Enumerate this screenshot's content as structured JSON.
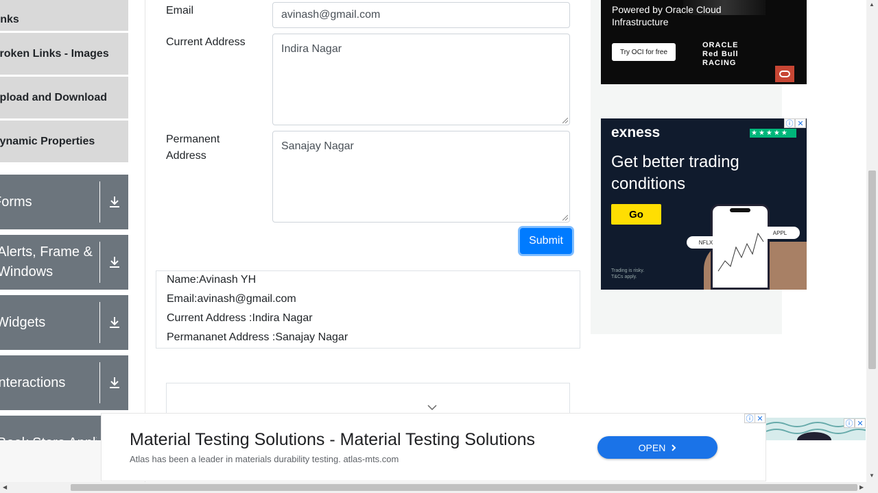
{
  "sidebar": {
    "sub_items": [
      {
        "label": "Links"
      },
      {
        "label": "Broken Links - Images"
      },
      {
        "label": "Upload and Download"
      },
      {
        "label": "Dynamic Properties"
      }
    ],
    "groups": [
      {
        "label": "Forms"
      },
      {
        "label": "Alerts, Frame & Windows"
      },
      {
        "label": "Widgets"
      },
      {
        "label": "Interactions"
      },
      {
        "label": "Book Store Application"
      }
    ]
  },
  "form": {
    "email_label": "Email",
    "email_value": "avinash@gmail.com",
    "current_address_label": "Current Address",
    "current_address_value": "Indira Nagar",
    "permanent_address_label": "Permanent Address",
    "permanent_address_value": "Sanajay Nagar",
    "submit_label": "Submit"
  },
  "output": {
    "name": "Name:Avinash YH",
    "email": "Email:avinash@gmail.com",
    "current_address": "Current Address :Indira Nagar",
    "permanent_address": "Permananet Address :Sanajay Nagar"
  },
  "ads": {
    "oracle": {
      "text": "Powered by Oracle Cloud Infrastructure",
      "button": "Try OCI for free",
      "logo": "ORACLE Red Bull RACING"
    },
    "exness": {
      "brand": "exness",
      "headline": "Get better trading conditions",
      "button": "Go",
      "disclaimer": "Trading is risky. T&Cs apply.",
      "pill_left": "NFLX",
      "pill_right": "APPL"
    },
    "bottom": {
      "title": "Material Testing Solutions - Material Testing Solutions",
      "subtitle": "Atlas has been a leader in materials durability testing. atlas-mts.com",
      "button": "OPEN"
    }
  },
  "icons": {
    "download": "download-icon",
    "chevron": "chevron-down-icon",
    "close": "close-icon",
    "info": "info-icon"
  },
  "colors": {
    "primary": "#007bff",
    "sidebar_group": "#6c757d",
    "sidebar_sub": "#d9d9d9",
    "ad_open": "#1a73e8"
  }
}
